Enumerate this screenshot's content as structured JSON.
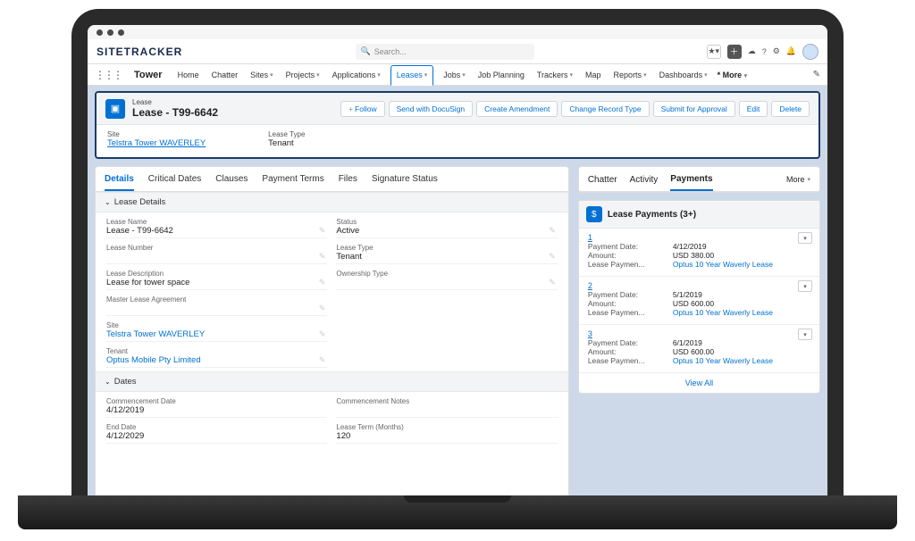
{
  "logo": "SITETRACKER",
  "search": {
    "placeholder": "Search..."
  },
  "appName": "Tower",
  "nav": [
    "Home",
    "Chatter",
    "Sites",
    "Projects",
    "Applications",
    "Leases",
    "Jobs",
    "Job Planning",
    "Trackers",
    "Map",
    "Reports",
    "Dashboards"
  ],
  "navMore": "* More",
  "record": {
    "type": "Lease",
    "title": "Lease - T99-6642",
    "actions": [
      "+ Follow",
      "Send with DocuSign",
      "Create Amendment",
      "Change Record Type",
      "Submit for Approval",
      "Edit",
      "Delete"
    ],
    "summary": {
      "siteLabel": "Site",
      "siteValue": "Telstra Tower WAVERLEY",
      "leaseTypeLabel": "Lease Type",
      "leaseTypeValue": "Tenant"
    }
  },
  "leftTabs": [
    "Details",
    "Critical Dates",
    "Clauses",
    "Payment Terms",
    "Files",
    "Signature Status"
  ],
  "sections": {
    "leaseDetails": "Lease Details",
    "dates": "Dates"
  },
  "details": {
    "leaseNameLbl": "Lease Name",
    "leaseName": "Lease - T99-6642",
    "statusLbl": "Status",
    "status": "Active",
    "leaseNumberLbl": "Lease Number",
    "leaseNumber": "",
    "leaseTypeLbl": "Lease Type",
    "leaseType": "Tenant",
    "leaseDescLbl": "Lease Description",
    "leaseDesc": "Lease for tower space",
    "ownershipLbl": "Ownership Type",
    "ownership": "",
    "masterLbl": "Master Lease Agreement",
    "master": "",
    "siteLbl": "Site",
    "site": "Telstra Tower WAVERLEY",
    "tenantLbl": "Tenant",
    "tenant": "Optus Mobile Pty Limited"
  },
  "dates": {
    "commDateLbl": "Commencement Date",
    "commDate": "4/12/2019",
    "commNotesLbl": "Commencement Notes",
    "commNotes": "",
    "endDateLbl": "End Date",
    "endDate": "4/12/2029",
    "leaseTermLbl": "Lease Term (Months)",
    "leaseTerm": "120"
  },
  "rightTabs": [
    "Chatter",
    "Activity",
    "Payments"
  ],
  "rightMore": "More",
  "paymentsCard": {
    "title": "Lease Payments (3+)",
    "viewAll": "View All",
    "items": [
      {
        "num": "1",
        "dateLbl": "Payment Date:",
        "date": "4/12/2019",
        "amtLbl": "Amount:",
        "amt": "USD 380.00",
        "agrLbl": "Lease Paymen...",
        "agr": "Optus 10 Year Waverly Lease"
      },
      {
        "num": "2",
        "dateLbl": "Payment Date:",
        "date": "5/1/2019",
        "amtLbl": "Amount:",
        "amt": "USD 600.00",
        "agrLbl": "Lease Paymen...",
        "agr": "Optus 10 Year Waverly Lease"
      },
      {
        "num": "3",
        "dateLbl": "Payment Date:",
        "date": "6/1/2019",
        "amtLbl": "Amount:",
        "amt": "USD 600.00",
        "agrLbl": "Lease Paymen...",
        "agr": "Optus 10 Year Waverly Lease"
      }
    ]
  }
}
